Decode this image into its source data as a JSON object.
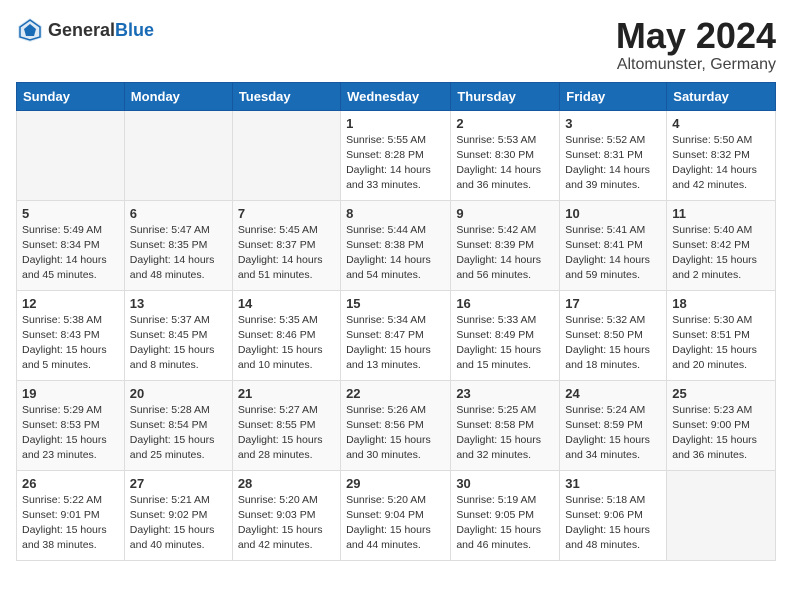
{
  "header": {
    "logo_general": "General",
    "logo_blue": "Blue",
    "month_title": "May 2024",
    "location": "Altomunster, Germany"
  },
  "weekdays": [
    "Sunday",
    "Monday",
    "Tuesday",
    "Wednesday",
    "Thursday",
    "Friday",
    "Saturday"
  ],
  "weeks": [
    [
      {
        "day": "",
        "info": ""
      },
      {
        "day": "",
        "info": ""
      },
      {
        "day": "",
        "info": ""
      },
      {
        "day": "1",
        "info": "Sunrise: 5:55 AM\nSunset: 8:28 PM\nDaylight: 14 hours\nand 33 minutes."
      },
      {
        "day": "2",
        "info": "Sunrise: 5:53 AM\nSunset: 8:30 PM\nDaylight: 14 hours\nand 36 minutes."
      },
      {
        "day": "3",
        "info": "Sunrise: 5:52 AM\nSunset: 8:31 PM\nDaylight: 14 hours\nand 39 minutes."
      },
      {
        "day": "4",
        "info": "Sunrise: 5:50 AM\nSunset: 8:32 PM\nDaylight: 14 hours\nand 42 minutes."
      }
    ],
    [
      {
        "day": "5",
        "info": "Sunrise: 5:49 AM\nSunset: 8:34 PM\nDaylight: 14 hours\nand 45 minutes."
      },
      {
        "day": "6",
        "info": "Sunrise: 5:47 AM\nSunset: 8:35 PM\nDaylight: 14 hours\nand 48 minutes."
      },
      {
        "day": "7",
        "info": "Sunrise: 5:45 AM\nSunset: 8:37 PM\nDaylight: 14 hours\nand 51 minutes."
      },
      {
        "day": "8",
        "info": "Sunrise: 5:44 AM\nSunset: 8:38 PM\nDaylight: 14 hours\nand 54 minutes."
      },
      {
        "day": "9",
        "info": "Sunrise: 5:42 AM\nSunset: 8:39 PM\nDaylight: 14 hours\nand 56 minutes."
      },
      {
        "day": "10",
        "info": "Sunrise: 5:41 AM\nSunset: 8:41 PM\nDaylight: 14 hours\nand 59 minutes."
      },
      {
        "day": "11",
        "info": "Sunrise: 5:40 AM\nSunset: 8:42 PM\nDaylight: 15 hours\nand 2 minutes."
      }
    ],
    [
      {
        "day": "12",
        "info": "Sunrise: 5:38 AM\nSunset: 8:43 PM\nDaylight: 15 hours\nand 5 minutes."
      },
      {
        "day": "13",
        "info": "Sunrise: 5:37 AM\nSunset: 8:45 PM\nDaylight: 15 hours\nand 8 minutes."
      },
      {
        "day": "14",
        "info": "Sunrise: 5:35 AM\nSunset: 8:46 PM\nDaylight: 15 hours\nand 10 minutes."
      },
      {
        "day": "15",
        "info": "Sunrise: 5:34 AM\nSunset: 8:47 PM\nDaylight: 15 hours\nand 13 minutes."
      },
      {
        "day": "16",
        "info": "Sunrise: 5:33 AM\nSunset: 8:49 PM\nDaylight: 15 hours\nand 15 minutes."
      },
      {
        "day": "17",
        "info": "Sunrise: 5:32 AM\nSunset: 8:50 PM\nDaylight: 15 hours\nand 18 minutes."
      },
      {
        "day": "18",
        "info": "Sunrise: 5:30 AM\nSunset: 8:51 PM\nDaylight: 15 hours\nand 20 minutes."
      }
    ],
    [
      {
        "day": "19",
        "info": "Sunrise: 5:29 AM\nSunset: 8:53 PM\nDaylight: 15 hours\nand 23 minutes."
      },
      {
        "day": "20",
        "info": "Sunrise: 5:28 AM\nSunset: 8:54 PM\nDaylight: 15 hours\nand 25 minutes."
      },
      {
        "day": "21",
        "info": "Sunrise: 5:27 AM\nSunset: 8:55 PM\nDaylight: 15 hours\nand 28 minutes."
      },
      {
        "day": "22",
        "info": "Sunrise: 5:26 AM\nSunset: 8:56 PM\nDaylight: 15 hours\nand 30 minutes."
      },
      {
        "day": "23",
        "info": "Sunrise: 5:25 AM\nSunset: 8:58 PM\nDaylight: 15 hours\nand 32 minutes."
      },
      {
        "day": "24",
        "info": "Sunrise: 5:24 AM\nSunset: 8:59 PM\nDaylight: 15 hours\nand 34 minutes."
      },
      {
        "day": "25",
        "info": "Sunrise: 5:23 AM\nSunset: 9:00 PM\nDaylight: 15 hours\nand 36 minutes."
      }
    ],
    [
      {
        "day": "26",
        "info": "Sunrise: 5:22 AM\nSunset: 9:01 PM\nDaylight: 15 hours\nand 38 minutes."
      },
      {
        "day": "27",
        "info": "Sunrise: 5:21 AM\nSunset: 9:02 PM\nDaylight: 15 hours\nand 40 minutes."
      },
      {
        "day": "28",
        "info": "Sunrise: 5:20 AM\nSunset: 9:03 PM\nDaylight: 15 hours\nand 42 minutes."
      },
      {
        "day": "29",
        "info": "Sunrise: 5:20 AM\nSunset: 9:04 PM\nDaylight: 15 hours\nand 44 minutes."
      },
      {
        "day": "30",
        "info": "Sunrise: 5:19 AM\nSunset: 9:05 PM\nDaylight: 15 hours\nand 46 minutes."
      },
      {
        "day": "31",
        "info": "Sunrise: 5:18 AM\nSunset: 9:06 PM\nDaylight: 15 hours\nand 48 minutes."
      },
      {
        "day": "",
        "info": ""
      }
    ]
  ]
}
